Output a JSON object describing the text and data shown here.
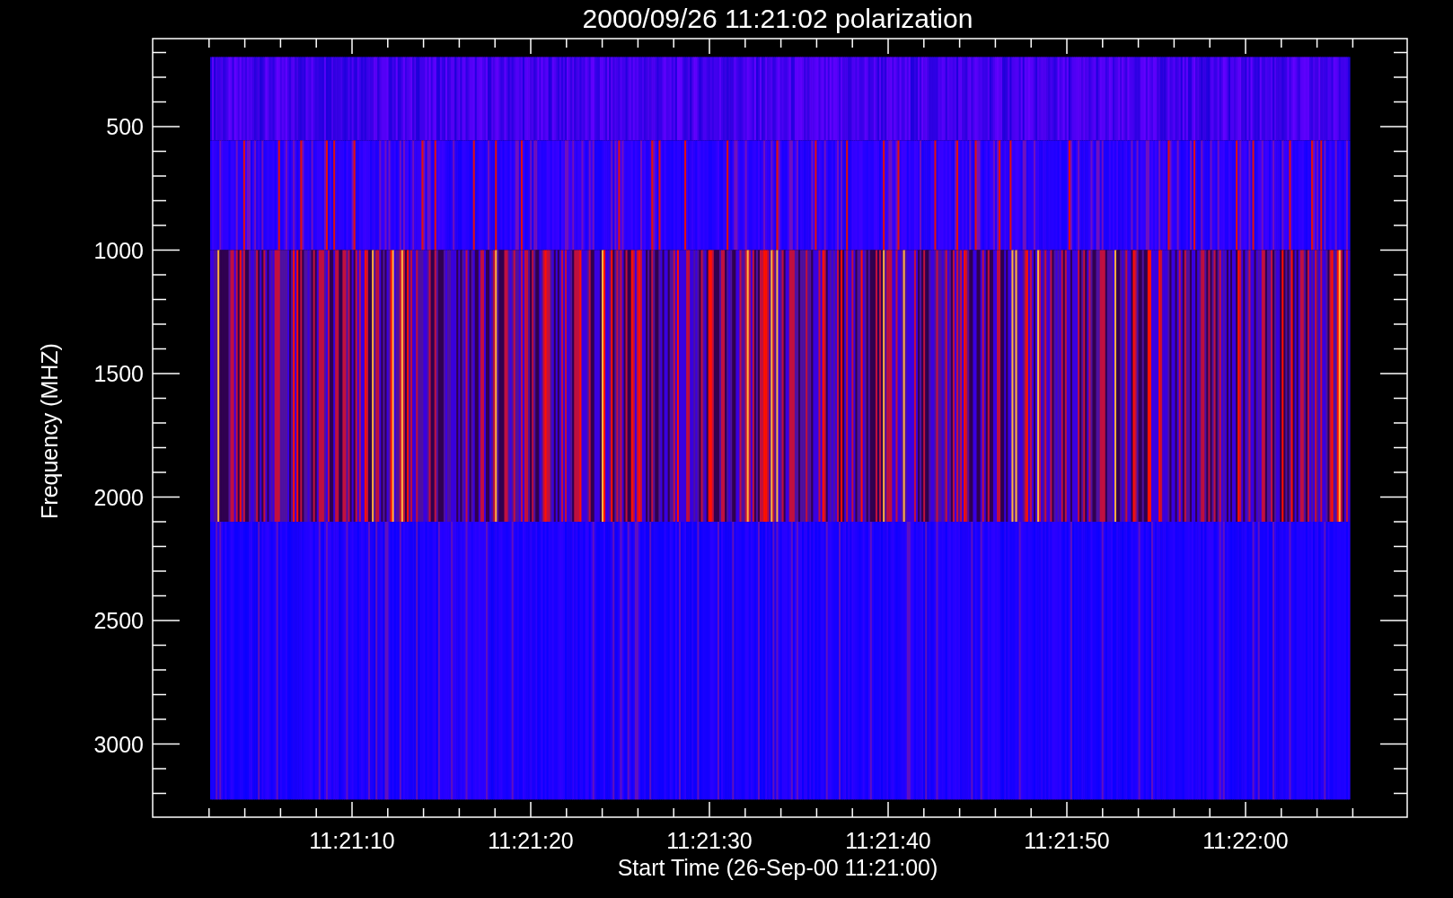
{
  "title": "2000/09/26 11:21:02 polarization",
  "ylabel": "Frequency (MHZ)",
  "xlabel": "Start Time (26-Sep-00 11:21:00)",
  "yticks": [
    "500",
    "1000",
    "1500",
    "2000",
    "2500",
    "3000"
  ],
  "xticks": [
    "11:21:10",
    "11:21:20",
    "11:21:30",
    "11:21:40",
    "11:21:50",
    "11:22:00"
  ]
}
